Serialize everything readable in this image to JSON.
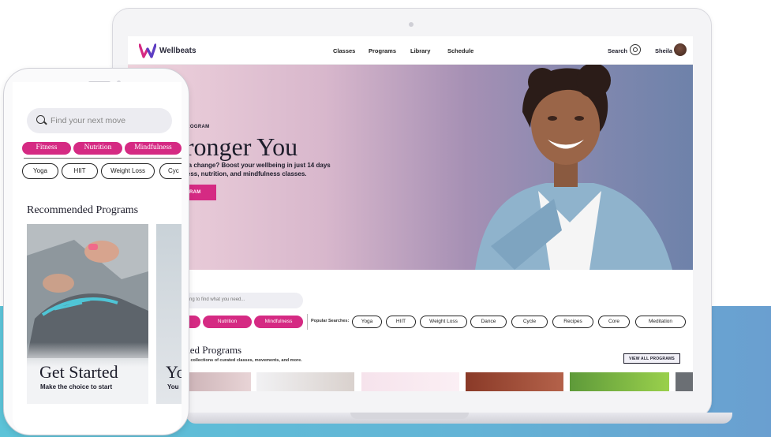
{
  "brand": {
    "name": "Wellbeats",
    "accent": "#d52a83"
  },
  "nav": {
    "links": [
      "Classes",
      "Programs",
      "Library",
      "Schedule"
    ],
    "search_label": "Search",
    "user_name": "Sheila"
  },
  "hero": {
    "eyebrow": "PROGRAM",
    "title": "tronger You",
    "copy_line1": "e a change? Boost your wellbeing in just 14 days",
    "copy_line2": "ness, nutrition, and mindfulness classes.",
    "button_label": "RAM"
  },
  "desktop_search": {
    "placeholder": "ng to find what you need..."
  },
  "desktop_tabs": [
    "Nutrition",
    "Mindfulness"
  ],
  "popular": {
    "label": "Popular Searches:",
    "chips": [
      "Yoga",
      "HIIT",
      "Weight Loss",
      "Dance",
      "Cycle",
      "Recipes",
      "Core",
      "Meditation"
    ]
  },
  "recommended": {
    "title": "ended Programs",
    "subtitle": "ured collections of curated classes, movements, and more.",
    "view_all": "VIEW ALL PROGRAMS"
  },
  "phone": {
    "search_placeholder": "Find your next move",
    "tabs": [
      "Fitness",
      "Nutrition",
      "Mindfulness"
    ],
    "chips": [
      "Yoga",
      "HIIT",
      "Weight Loss",
      "Cyc"
    ],
    "section_title": "Recommended Programs",
    "cards": [
      {
        "title": "Get Started",
        "subtitle": "Make the choice to start"
      },
      {
        "title": "Yo",
        "subtitle": "You"
      }
    ]
  }
}
